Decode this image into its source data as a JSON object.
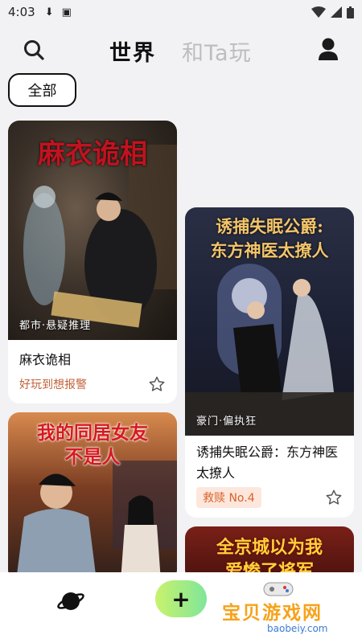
{
  "status_bar": {
    "time": "4:03"
  },
  "header": {
    "tab_world": "世界",
    "tab_play": "和Ta玩"
  },
  "filter_chip": "全部",
  "cards": [
    {
      "cover_title": "麻衣诡相",
      "genre": "都市·悬疑推理",
      "title": "麻衣诡相",
      "tag": "好玩到想报警"
    },
    {
      "cover_title_line1": "诱捕失眠公爵:",
      "cover_title_line2": "东方神医太撩人",
      "genre": "豪门·偏执狂",
      "title": "诱捕失眠公爵：东方神医太撩人",
      "rank": "救赎 No.4"
    },
    {
      "cover_title_line1": "我的同居女友",
      "cover_title_line2": "不是人"
    },
    {
      "cover_title_line1": "全京城以为我",
      "cover_title_line2": "爱惨了将军"
    }
  ],
  "watermark": {
    "text": "宝贝游戏网",
    "url": "baobeiy.com"
  },
  "colors": {
    "accent_tag": "#c0623a",
    "rank_bg": "#fde7dc",
    "plus_gradient_start": "#c9f26b",
    "plus_gradient_end": "#7fe69a"
  }
}
